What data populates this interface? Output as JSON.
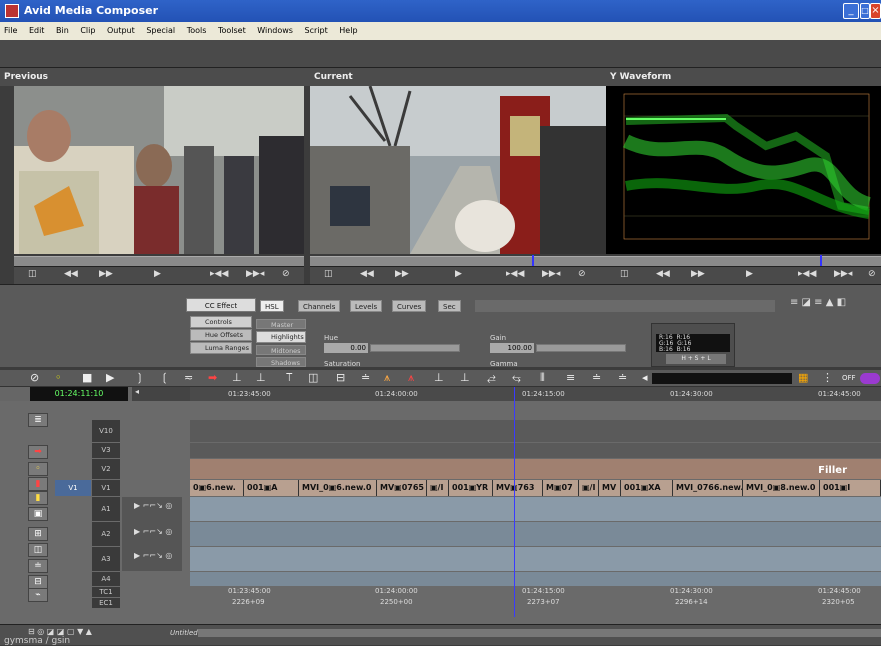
{
  "app": {
    "title": "Avid Media Composer",
    "min": "_",
    "max": "□",
    "close": "×"
  },
  "menu": [
    "File",
    "Edit",
    "Bin",
    "Clip",
    "Output",
    "Special",
    "Tools",
    "Toolset",
    "Windows",
    "Script",
    "Help"
  ],
  "monitors": {
    "previous": "Previous",
    "current": "Current",
    "waveform": "Y Waveform"
  },
  "cc": {
    "effect_button": "CC Effect",
    "tabs": [
      "HSL",
      "Channels",
      "Levels",
      "Curves",
      "Sec"
    ],
    "left_buttons": [
      "Controls",
      "Hue Offsets",
      "Luma Ranges"
    ],
    "range_buttons": [
      "Master",
      "Highlights",
      "Midtones",
      "Shadows"
    ],
    "hue_label": "Hue",
    "hue_value": "0.00",
    "gain_label": "Gain",
    "gain_value": "100.00",
    "saturation_label": "Saturation",
    "gamma_label": "Gamma",
    "rgb_readout": [
      "R:16",
      "G:16",
      "B:16"
    ],
    "rgb_readout2": [
      "R:16",
      "G:16",
      "B:16"
    ],
    "mode_select": "H + S + L"
  },
  "timeline": {
    "timecode": "01:24:11:10",
    "ruler": [
      "01:23:45:00",
      "01:24:00:00",
      "01:24:15:00",
      "01:24:30:00",
      "01:24:45:00"
    ],
    "tracks": [
      "V10",
      "V3",
      "V2",
      "V1",
      "A1",
      "A2",
      "A3",
      "A4",
      "TC1",
      "EC1"
    ],
    "source_v1": "V1",
    "filler": "Filler",
    "v1_clips": [
      "0▣6.new.",
      "001▣A",
      "MVI_0▣6.new.0",
      "MV▣0765",
      "▣/I",
      "001▣YR",
      "MV▣763",
      "M▣07",
      "▣/I",
      "MV",
      "001▣XA",
      "MVI_0766.new.",
      "MVI_0▣8.new.0",
      "001▣I"
    ],
    "tc_labels": [
      "01:23:45:00",
      "01:24:00:00",
      "01:24:15:00",
      "01:24:30:00",
      "01:24:45:00"
    ],
    "ec_labels": [
      "2226+09",
      "2250+00",
      "2273+07",
      "2296+14",
      "2320+05"
    ],
    "untitled": "Untitled"
  },
  "bin": {
    "label": "gymsma / gsin"
  },
  "colors": {
    "titlebar": "#2a5bc4",
    "clip_v": "#b8a090",
    "clip_a": "#9aa8b8",
    "filler": "#a08070",
    "accent": "#9a3ad0",
    "tc_green": "#66ff66"
  }
}
